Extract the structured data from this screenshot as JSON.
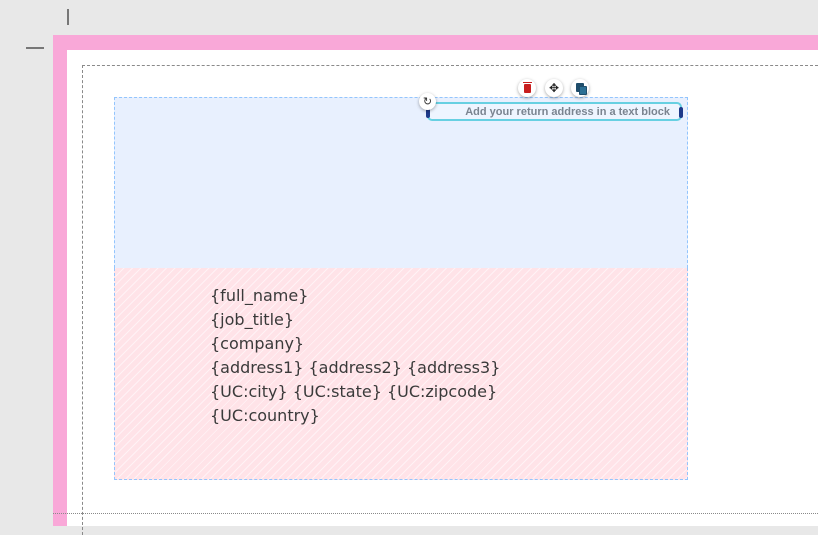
{
  "canvas": {
    "colors": {
      "workspace": "#e8e8e8",
      "bleed": "#f9a8d8",
      "return_zone": "#e8f0fe",
      "address_zone": "#ffe3e8",
      "text_block_border": "#67d0e2"
    }
  },
  "return_block": {
    "placeholder": "Add your return address in a text block"
  },
  "toolbar": {
    "rotate_icon": "↻",
    "delete_icon": "trash-icon",
    "move_icon": "✥",
    "copy_icon": "copy-icon"
  },
  "address_block": {
    "lines": [
      "{full_name}",
      "{job_title}",
      "{company}",
      "{address1} {address2} {address3}",
      "{UC:city} {UC:state} {UC:zipcode}",
      "{UC:country}"
    ]
  }
}
